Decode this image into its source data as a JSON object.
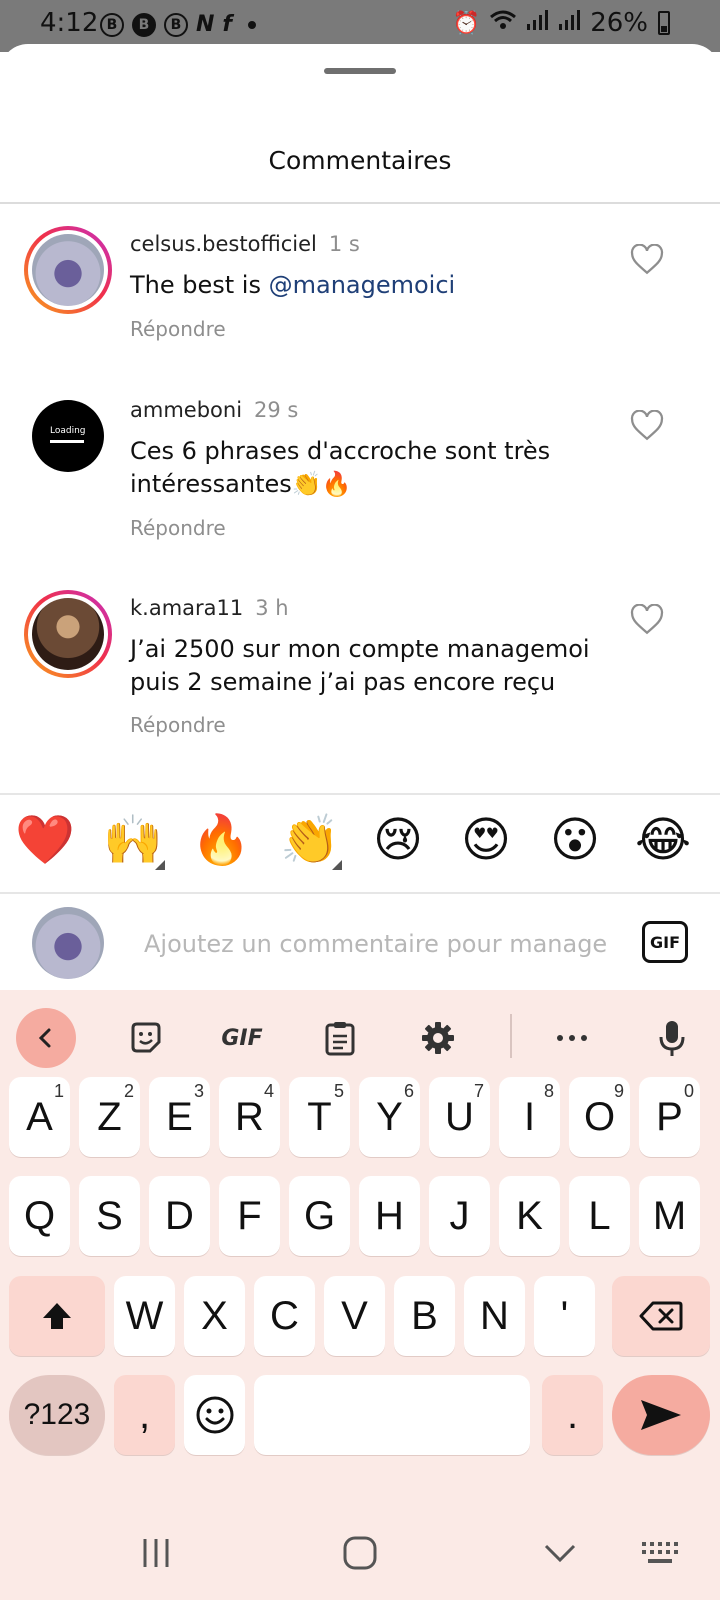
{
  "status_bar": {
    "time": "4:12",
    "notification_icons": [
      "B",
      "B",
      "B"
    ],
    "battery": "26%"
  },
  "sheet": {
    "title": "Commentaires"
  },
  "comments": [
    {
      "username": "celsus.bestofficiel",
      "time": "1 s",
      "text_prefix": "The best is ",
      "mention": "@managemoici",
      "reply": "Répondre"
    },
    {
      "username": "ammeboni",
      "time": "29 s",
      "text": "Ces 6 phrases d'accroche sont très intéressantes👏🔥",
      "avatar_text": "Loading",
      "reply": "Répondre"
    },
    {
      "username": "k.amara11",
      "time": "3 h",
      "text": "J’ai 2500 sur mon compte managemoi puis 2 semaine j’ai pas encore reçu",
      "reply": "Répondre"
    }
  ],
  "reactions": [
    "❤️",
    "🙌",
    "🔥",
    "👏",
    "😢",
    "😍",
    "😮",
    "😂"
  ],
  "comment_input": {
    "placeholder": "Ajoutez un commentaire pour manage",
    "gif_label": "GIF"
  },
  "keyboard": {
    "toolbar": {
      "gif_label": "GIF"
    },
    "row1": [
      {
        "key": "A",
        "hint": "1"
      },
      {
        "key": "Z",
        "hint": "2"
      },
      {
        "key": "E",
        "hint": "3"
      },
      {
        "key": "R",
        "hint": "4"
      },
      {
        "key": "T",
        "hint": "5"
      },
      {
        "key": "Y",
        "hint": "6"
      },
      {
        "key": "U",
        "hint": "7"
      },
      {
        "key": "I",
        "hint": "8"
      },
      {
        "key": "O",
        "hint": "9"
      },
      {
        "key": "P",
        "hint": "0"
      }
    ],
    "row2": [
      "Q",
      "S",
      "D",
      "F",
      "G",
      "H",
      "J",
      "K",
      "L",
      "M"
    ],
    "row3": [
      "W",
      "X",
      "C",
      "V",
      "B",
      "N",
      "'"
    ],
    "symbols_label": "?123",
    "comma": ",",
    "period": "."
  }
}
